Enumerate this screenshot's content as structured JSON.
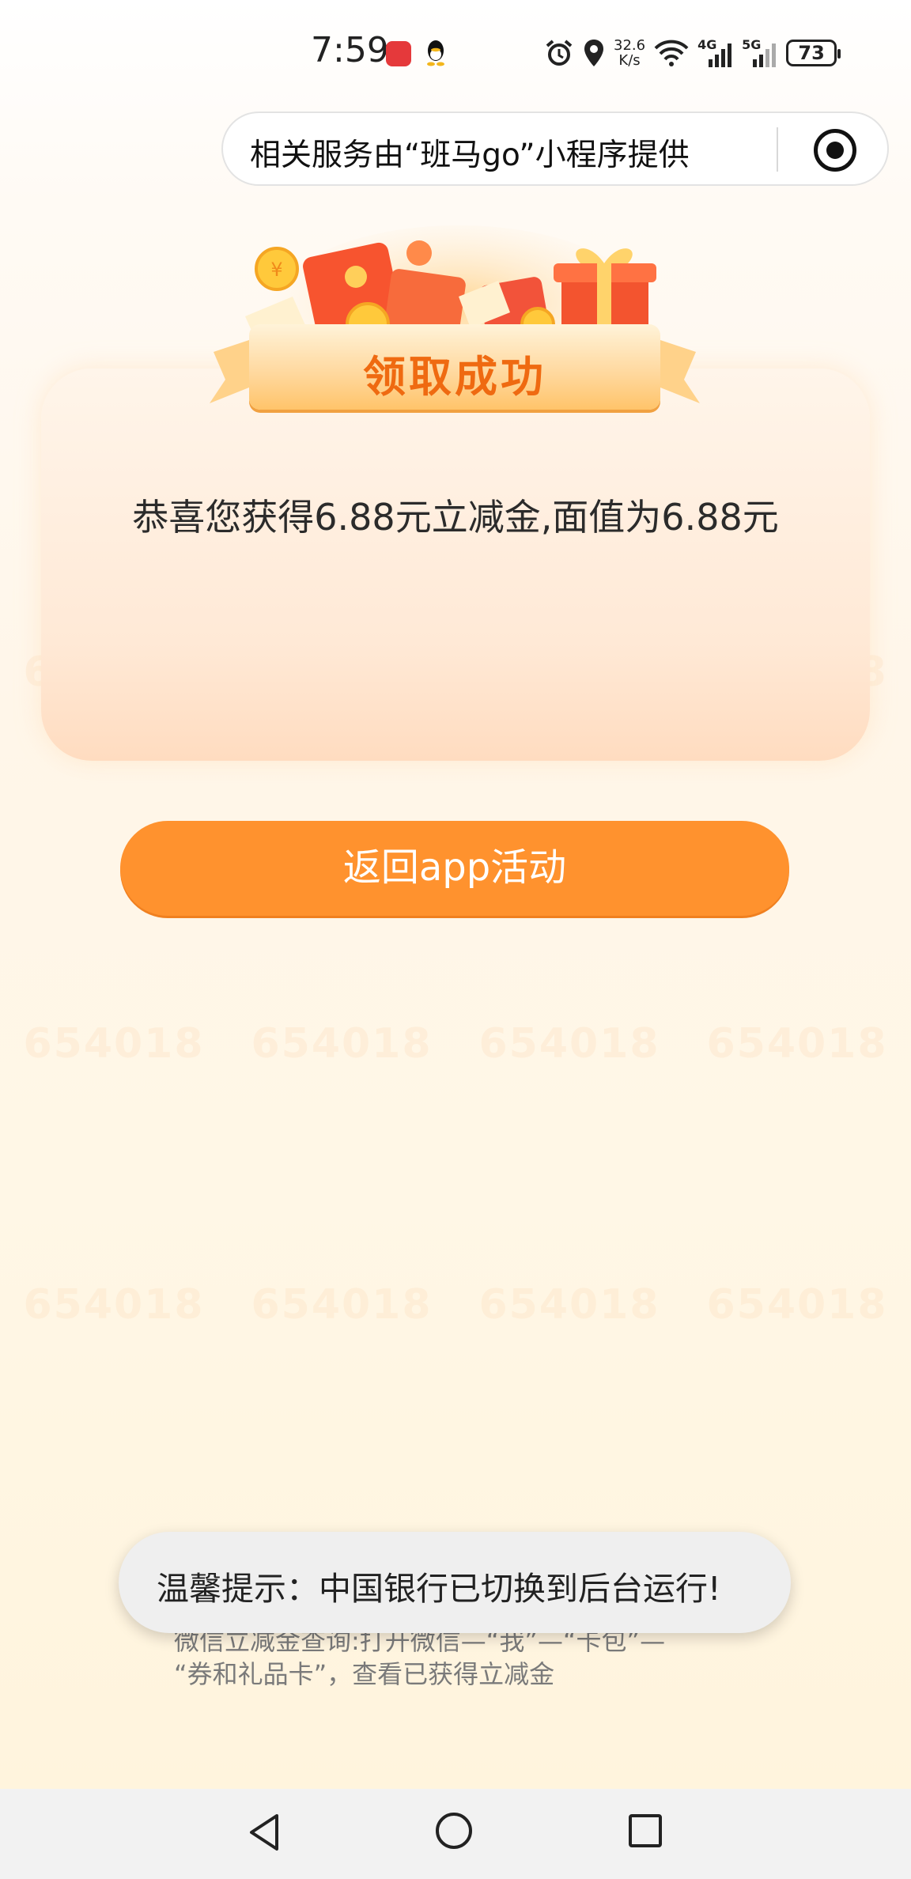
{
  "status_bar": {
    "time": "7:59",
    "net_speed_value": "32.6",
    "net_speed_unit": "K/s",
    "signal_1": "4G",
    "signal_2": "5G",
    "battery": "73",
    "icons": [
      "huawei-store-icon",
      "qq-icon",
      "alarm-icon",
      "location-icon",
      "wifi-icon",
      "signal-icon",
      "battery-icon"
    ]
  },
  "capsule": {
    "label": "相关服务由“班马go”小程序提供"
  },
  "banner": {
    "title": "领取成功"
  },
  "card": {
    "message": "恭喜您获得6.88元立减金,面值为6.88元"
  },
  "button": {
    "label": "返回app活动"
  },
  "toast": {
    "text": "温馨提示：中国银行已切换到后台运行!"
  },
  "hint": {
    "line1": "微信立减金查询:打开微信—“我”—“卡包”—",
    "line2": "“券和礼品卡”，查看已获得立减金"
  },
  "watermark": "654018",
  "colors": {
    "accent": "#ff922e",
    "title": "#ef6a11",
    "card_bg": "#ffe9d6"
  }
}
